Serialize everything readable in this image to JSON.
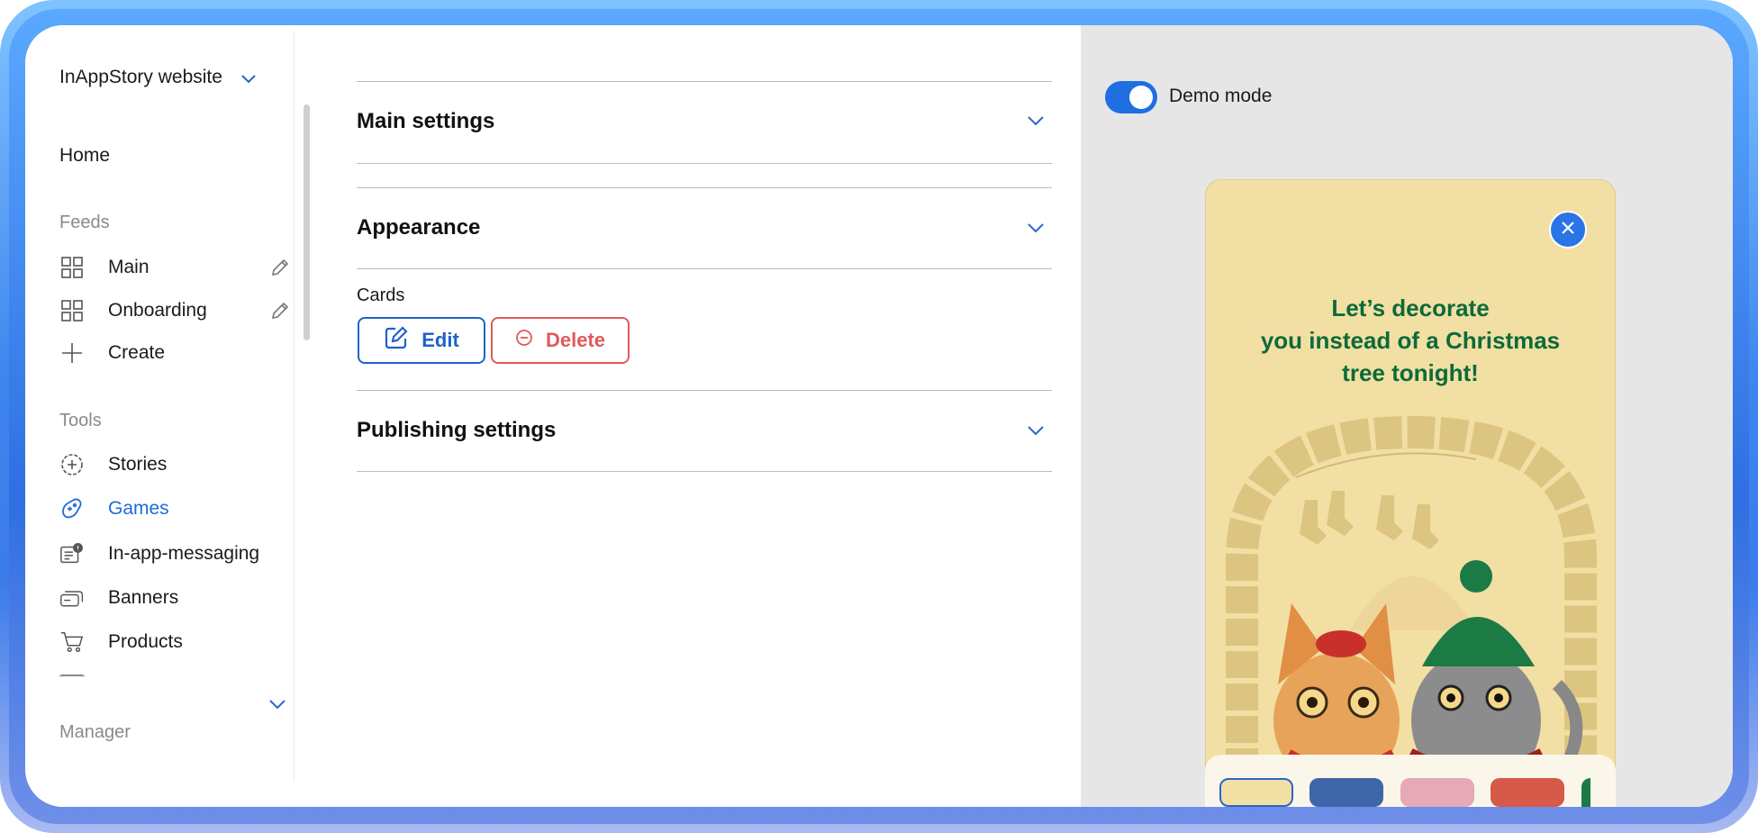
{
  "sidebar": {
    "workspace": "InAppStory website",
    "home": "Home",
    "sections": {
      "feeds": "Feeds",
      "tools": "Tools",
      "manager": "Manager"
    },
    "feeds": [
      {
        "label": "Main",
        "icon": "grid-icon"
      },
      {
        "label": "Onboarding",
        "icon": "grid-icon"
      },
      {
        "label": "Create",
        "icon": "plus-icon"
      }
    ],
    "tools": [
      {
        "label": "Stories",
        "icon": "stories-icon"
      },
      {
        "label": "Games",
        "icon": "gamepad-icon",
        "active": true
      },
      {
        "label": "In-app-messaging",
        "icon": "message-icon"
      },
      {
        "label": "Banners",
        "icon": "banners-icon"
      },
      {
        "label": "Products",
        "icon": "cart-icon"
      }
    ]
  },
  "main": {
    "sections": [
      {
        "title": "Main settings"
      },
      {
        "title": "Appearance"
      },
      {
        "title": "Publishing settings"
      }
    ],
    "cards_label": "Cards",
    "edit_label": "Edit",
    "delete_label": "Delete"
  },
  "preview": {
    "demo_mode_label": "Demo mode",
    "demo_mode_on": true,
    "story_title_lines": [
      "Let’s decorate",
      "you instead of a Christmas",
      "tree tonight!"
    ]
  },
  "colors": {
    "accent": "#1f6fe3",
    "active_nav": "#1f6bd6",
    "danger": "#e05a5a",
    "story_bg": "#f2dfa3",
    "story_title": "#0d6a3b"
  }
}
